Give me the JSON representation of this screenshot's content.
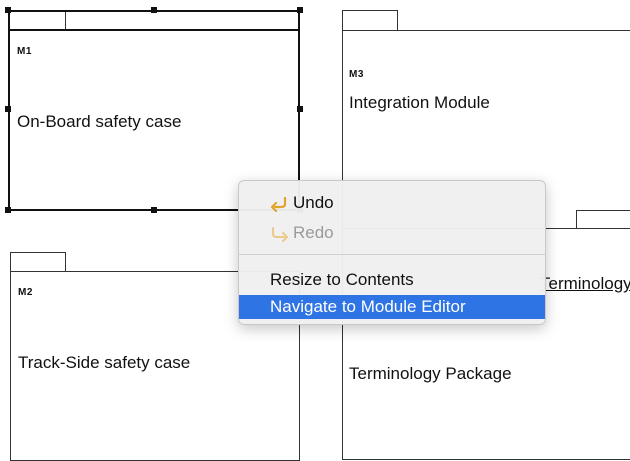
{
  "modules": {
    "m1": {
      "id": "M1",
      "name": "On-Board safety case"
    },
    "m2": {
      "id": "M2",
      "name": "Track-Side safety case"
    },
    "m3": {
      "id": "M3",
      "name": "Integration Module"
    },
    "m4": {
      "name": "Terminology Package",
      "overlap_text": "Terminology"
    }
  },
  "context_menu": {
    "undo": {
      "label": "Undo",
      "icon": "undo-arrow-icon"
    },
    "redo": {
      "label": "Redo",
      "icon": "redo-arrow-icon"
    },
    "resize": {
      "label": "Resize to Contents"
    },
    "navigate": {
      "label": "Navigate to Module Editor"
    }
  },
  "colors": {
    "highlight": "#2f74e4",
    "icon": "#e0a52a"
  }
}
